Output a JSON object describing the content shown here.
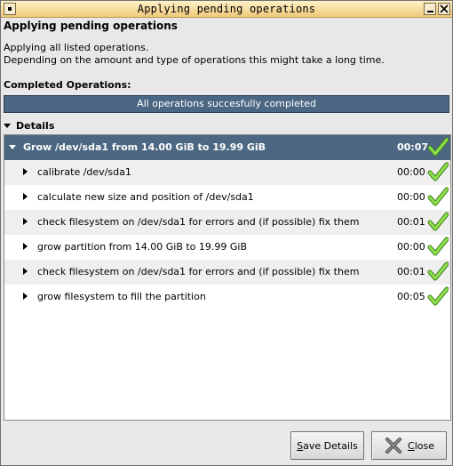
{
  "window": {
    "title": "Applying pending operations"
  },
  "header": "Applying pending operations",
  "description": [
    "Applying all listed operations.",
    "Depending on the amount and type of operations this might take a long time."
  ],
  "completed_label": "Completed Operations:",
  "progress": {
    "text": "All operations succesfully completed",
    "fraction": 1.0
  },
  "details_label": "Details",
  "operations": [
    {
      "label": "Grow /dev/sda1 from 14.00 GiB to 19.99 GiB",
      "time": "00:07",
      "status": "success",
      "icon": "check-icon"
    },
    {
      "label": "calibrate /dev/sda1",
      "time": "00:00",
      "status": "success",
      "icon": "check-icon"
    },
    {
      "label": "calculate new size and position of /dev/sda1",
      "time": "00:00",
      "status": "success",
      "icon": "check-icon"
    },
    {
      "label": "check filesystem on /dev/sda1 for errors and (if possible) fix them",
      "time": "00:01",
      "status": "success",
      "icon": "check-icon"
    },
    {
      "label": "grow partition from 14.00 GiB to 19.99 GiB",
      "time": "00:00",
      "status": "success",
      "icon": "check-icon"
    },
    {
      "label": "check filesystem on /dev/sda1 for errors and (if possible) fix them",
      "time": "00:01",
      "status": "success",
      "icon": "check-icon"
    },
    {
      "label": "grow filesystem to fill the partition",
      "time": "00:05",
      "status": "success",
      "icon": "check-icon"
    }
  ],
  "buttons": {
    "save_details": {
      "mnemonic": "S",
      "rest": "ave Details"
    },
    "close": {
      "mnemonic": "C",
      "rest": "lose"
    }
  },
  "colors": {
    "selection": "#4d6782",
    "progress": "#4c6784",
    "titlebar": "#efc97a",
    "check": "#7ccf3a"
  }
}
